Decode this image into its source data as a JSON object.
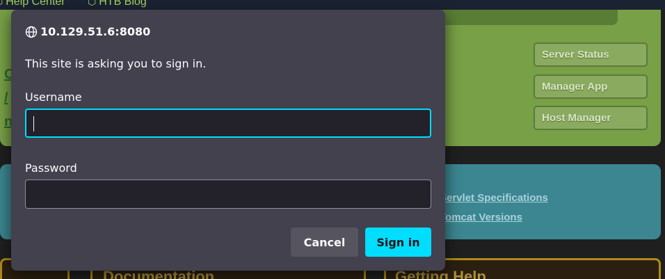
{
  "bookmarks": [
    {
      "label": "Help Center",
      "icon": "htb-cube-icon"
    },
    {
      "label": "HTB Blog",
      "icon": "htb-cube-icon"
    }
  ],
  "background": {
    "server_status": "Server Status",
    "manager_app": "Manager App",
    "host_manager": "Host Manager",
    "servlet_specs": "Servlet Specifications",
    "tomcat_versions": "Tomcat Versions",
    "documentation": "Documentation",
    "getting_help": "Getting Help"
  },
  "dialog": {
    "host": "10.129.51.6:8080",
    "message": "This site is asking you to sign in.",
    "username_label": "Username",
    "username_value": "",
    "password_label": "Password",
    "password_value": "",
    "cancel_label": "Cancel",
    "signin_label": "Sign in"
  },
  "colors": {
    "accent": "#00ddff",
    "dialog_bg": "#42414d",
    "field_bg": "#23222b",
    "panel_green": "#78a047",
    "panel_teal": "#3b8690"
  }
}
